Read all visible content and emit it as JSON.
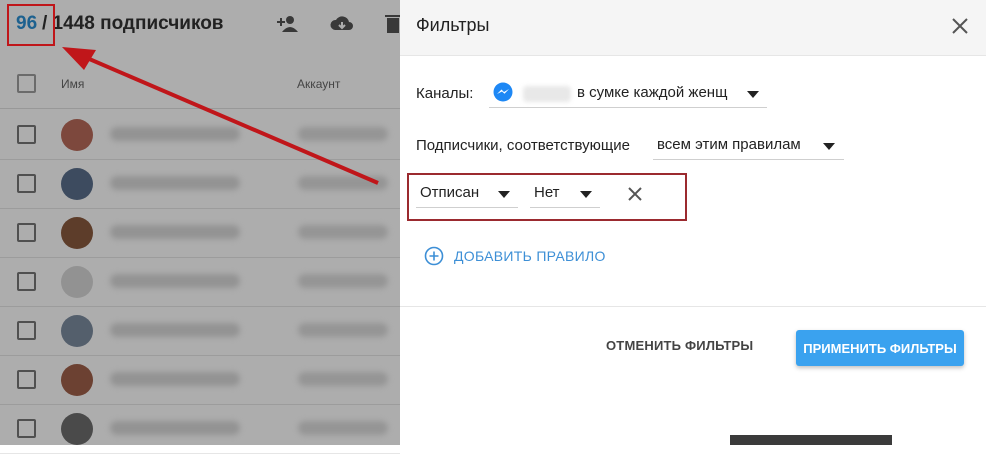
{
  "list": {
    "selected_count": "96",
    "total_label": "/ 1448 подписчиков",
    "columns": {
      "name": "Имя",
      "account": "Аккаунт"
    },
    "rows": [
      {
        "avatar_color": "#b86a5a"
      },
      {
        "avatar_color": "#5a6f8c"
      },
      {
        "avatar_color": "#8a5a3e"
      },
      {
        "avatar_color": "#d8d8d8"
      },
      {
        "avatar_color": "#7c8ca0"
      },
      {
        "avatar_color": "#a0604a"
      },
      {
        "avatar_color": "#6e6e6e"
      }
    ]
  },
  "filters": {
    "title": "Фильтры",
    "channels_label": "Каналы:",
    "channel_value": "в сумке каждой женщ",
    "subscribers_label": "Подписчики, соответствующие",
    "match_value": "всем этим правилам",
    "rule": {
      "field": "Отписан",
      "value": "Нет"
    },
    "add_rule_label": "ДОБАВИТЬ ПРАВИЛО",
    "cancel_label": "ОТМЕНИТЬ ФИЛЬТРЫ",
    "apply_label": "ПРИМЕНИТЬ ФИЛЬТРЫ"
  },
  "colors": {
    "accent": "#3aa2ef",
    "link": "#3d8fd6",
    "annotation_red": "#c0161a"
  },
  "icons": [
    "add-users-icon",
    "download-icon",
    "delete-icon",
    "close-icon",
    "messenger-icon",
    "add-circle-icon",
    "remove-rule-icon",
    "caret-down-icon"
  ]
}
